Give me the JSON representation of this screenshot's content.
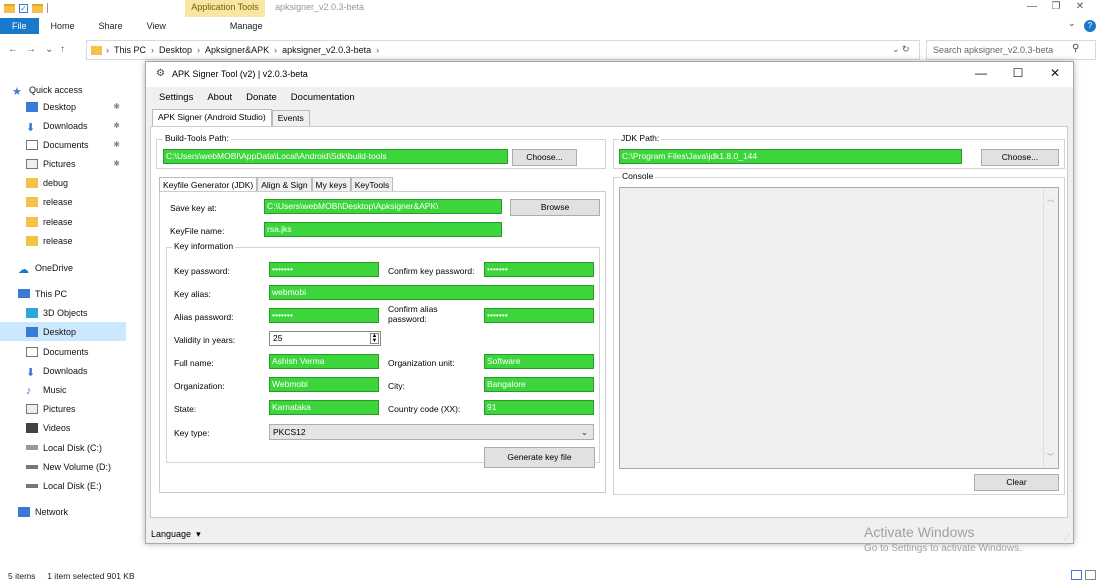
{
  "explorer": {
    "context_tab": "Application Tools",
    "window_title": "apksigner_v2.0.3-beta",
    "ribbon_tabs": [
      "File",
      "Home",
      "Share",
      "View"
    ],
    "manage_tab": "Manage",
    "breadcrumb": [
      "This PC",
      "Desktop",
      "Apksigner&APK",
      "apksigner_v2.0.3-beta"
    ],
    "search_placeholder": "Search apksigner_v2.0.3-beta",
    "nav": {
      "quick_access": "Quick access",
      "pinned": [
        "Desktop",
        "Downloads",
        "Documents",
        "Pictures"
      ],
      "folders": [
        "debug",
        "release",
        "release",
        "release"
      ],
      "onedrive": "OneDrive",
      "this_pc": "This PC",
      "pc_items": [
        "3D Objects",
        "Desktop",
        "Documents",
        "Downloads",
        "Music",
        "Pictures",
        "Videos",
        "Local Disk (C:)",
        "New Volume (D:)",
        "Local Disk (E:)"
      ],
      "network": "Network"
    },
    "status": {
      "items": "5 items",
      "selected": "1 item selected  901 KB"
    }
  },
  "apk": {
    "title": "APK Signer Tool (v2) | v2.0.3-beta",
    "menu": [
      "Settings",
      "About",
      "Donate",
      "Documentation"
    ],
    "tabs": [
      "APK Signer (Android Studio)",
      "Events"
    ],
    "build_tools_label": "Build-Tools Path:",
    "build_tools_path": "C:\\Users\\webMOBI\\AppData\\Local\\Android\\Sdk\\build-tools",
    "choose_label": "Choose...",
    "jdk_label": "JDK Path:",
    "jdk_path": "C:\\Program Files\\Java\\jdk1.8.0_144",
    "subtabs": [
      "Keyfile Generator (JDK)",
      "Align & Sign",
      "My keys",
      "KeyTools"
    ],
    "save_key_label": "Save key at:",
    "save_key_value": "C:\\Users\\webMOBI\\Desktop\\Apksigner&APK\\",
    "browse_label": "Browse",
    "keyfile_name_label": "KeyFile name:",
    "keyfile_name_value": "rsa.jks",
    "key_info_label": "Key information",
    "key_password_label": "Key password:",
    "key_password_value": "•••••••",
    "confirm_key_password_label": "Confirm key password:",
    "confirm_key_password_value": "•••••••",
    "key_alias_label": "Key alias:",
    "key_alias_value": "webmobi",
    "alias_password_label": "Alias password:",
    "alias_password_value": "•••••••",
    "confirm_alias_password_label": "Confirm alias password:",
    "confirm_alias_password_value": "•••••••",
    "validity_label": "Validity in years:",
    "validity_value": "25",
    "full_name_label": "Full name:",
    "full_name_value": "Ashish Verma",
    "org_unit_label": "Organization unit:",
    "org_unit_value": "Software",
    "organization_label": "Organization:",
    "organization_value": "Webmobi",
    "city_label": "City:",
    "city_value": "Bangalore",
    "state_label": "State:",
    "state_value": "Karnataka",
    "country_label": "Country code (XX):",
    "country_value": "91",
    "key_type_label": "Key type:",
    "key_type_value": "PKCS12",
    "generate_label": "Generate key file",
    "console_label": "Console",
    "clear_label": "Clear",
    "language_label": "Language"
  },
  "watermark": {
    "line1": "Activate Windows",
    "line2": "Go to Settings to activate Windows."
  },
  "colors": {
    "field_green": "#3cd63c",
    "ribbon_blue": "#1979ca",
    "context_yellow": "#f7e7a3"
  }
}
